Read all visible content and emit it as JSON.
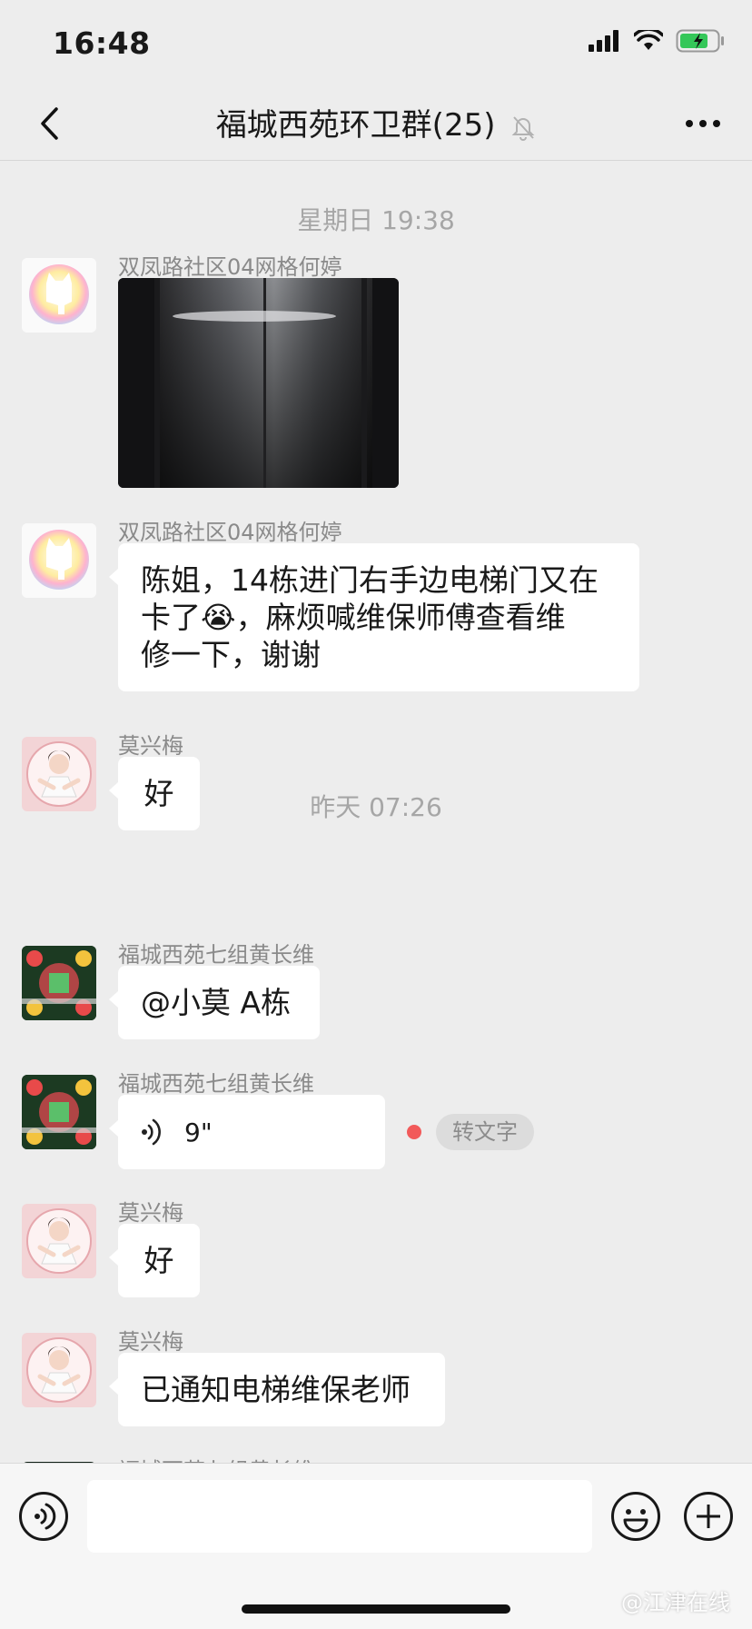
{
  "status_bar": {
    "time": "16:48"
  },
  "nav": {
    "title": "福城西苑环卫群(25)"
  },
  "timestamps": {
    "t1": "星期日 19:38",
    "t2": "昨天 07:26"
  },
  "messages": [
    {
      "sender": "双凤路社区04网格何婷",
      "type": "image"
    },
    {
      "sender": "双凤路社区04网格何婷",
      "line1": "陈姐，14栋进门右手边电梯门又在",
      "line2a": "卡了",
      "emoji": "😭",
      "line2b": "，麻烦喊维保师傅查看维",
      "line3": "修一下，谢谢"
    },
    {
      "sender": "莫兴梅",
      "text": "好"
    },
    {
      "sender": "福城西苑七组黄长维",
      "text": "@小莫 A栋"
    },
    {
      "sender": "福城西苑七组黄长维",
      "duration": "9\"",
      "to_text_label": "转文字"
    },
    {
      "sender": "莫兴梅",
      "text": "好"
    },
    {
      "sender": "莫兴梅",
      "text": "已通知电梯维保老师"
    },
    {
      "sender": "福城西苑七组黄长维"
    }
  ],
  "watermark": "@江津在线"
}
